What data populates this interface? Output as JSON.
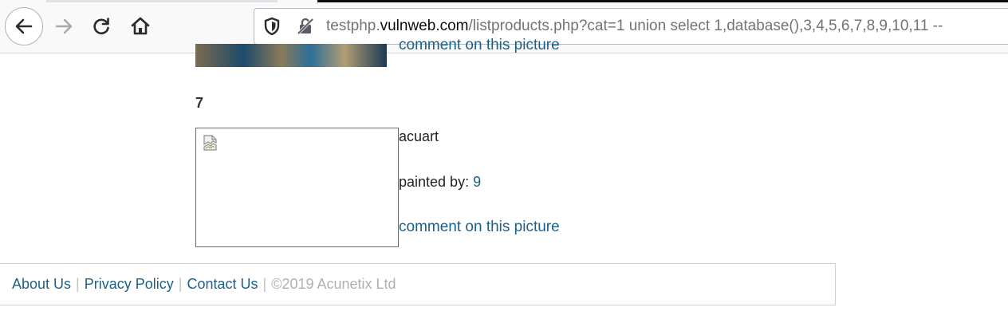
{
  "browser": {
    "url_prefix": "testphp.",
    "url_domain": "vulnweb.com",
    "url_path": "/listproducts.php?cat=1 union select 1,database(),3,4,5,6,7,8,9,10,11 --"
  },
  "previous_item": {
    "comment_link": "comment on this picture"
  },
  "item": {
    "id": "7",
    "title": "acuart",
    "painted_by_label": "painted by:",
    "artist": "9",
    "comment_link": "comment on this picture"
  },
  "footer": {
    "about": "About Us",
    "privacy": "Privacy Policy",
    "contact": "Contact Us",
    "separator": "|",
    "copyright": "©2019 Acunetix Ltd"
  },
  "colors": {
    "link": "#1c5f87",
    "toolbar": "#f9f9fa",
    "muted": "#b0b0b0"
  },
  "icons": [
    "back-arrow-icon",
    "forward-arrow-icon",
    "reload-icon",
    "home-icon",
    "shield-icon",
    "insecure-lock-icon",
    "broken-image-icon"
  ]
}
